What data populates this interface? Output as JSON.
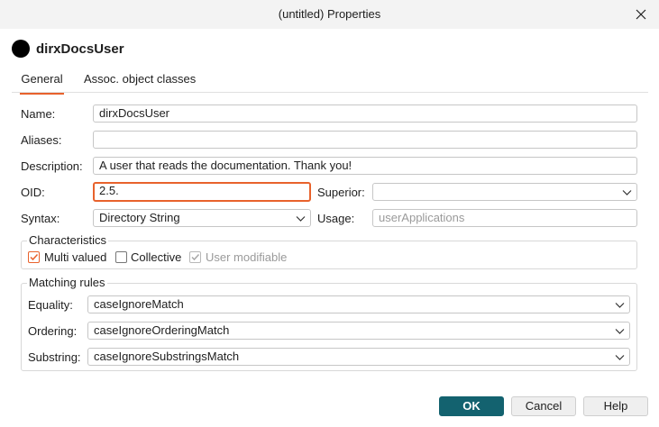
{
  "window": {
    "title": "(untitled) Properties"
  },
  "header": {
    "name": "dirxDocsUser"
  },
  "tabs": [
    {
      "label": "General",
      "active": true
    },
    {
      "label": "Assoc. object classes",
      "active": false
    }
  ],
  "form": {
    "name_label": "Name:",
    "name_value": "dirxDocsUser",
    "aliases_label": "Aliases:",
    "aliases_value": "",
    "description_label": "Description:",
    "description_value": "A user that reads the documentation. Thank you!",
    "oid_label": "OID:",
    "oid_value": "2.5.",
    "superior_label": "Superior:",
    "superior_value": "",
    "syntax_label": "Syntax:",
    "syntax_value": "Directory String",
    "usage_label": "Usage:",
    "usage_value": "userApplications"
  },
  "characteristics": {
    "title": "Characteristics",
    "multi_valued_label": "Multi valued",
    "multi_valued_checked": true,
    "collective_label": "Collective",
    "collective_checked": false,
    "user_modifiable_label": "User modifiable",
    "user_modifiable_checked": true
  },
  "matching_rules": {
    "title": "Matching rules",
    "equality_label": "Equality:",
    "equality_value": "caseIgnoreMatch",
    "ordering_label": "Ordering:",
    "ordering_value": "caseIgnoreOrderingMatch",
    "substring_label": "Substring:",
    "substring_value": "caseIgnoreSubstringsMatch"
  },
  "buttons": {
    "ok": "OK",
    "cancel": "Cancel",
    "help": "Help"
  },
  "colors": {
    "accent": "#e8622c",
    "primary_button": "#13626f"
  }
}
